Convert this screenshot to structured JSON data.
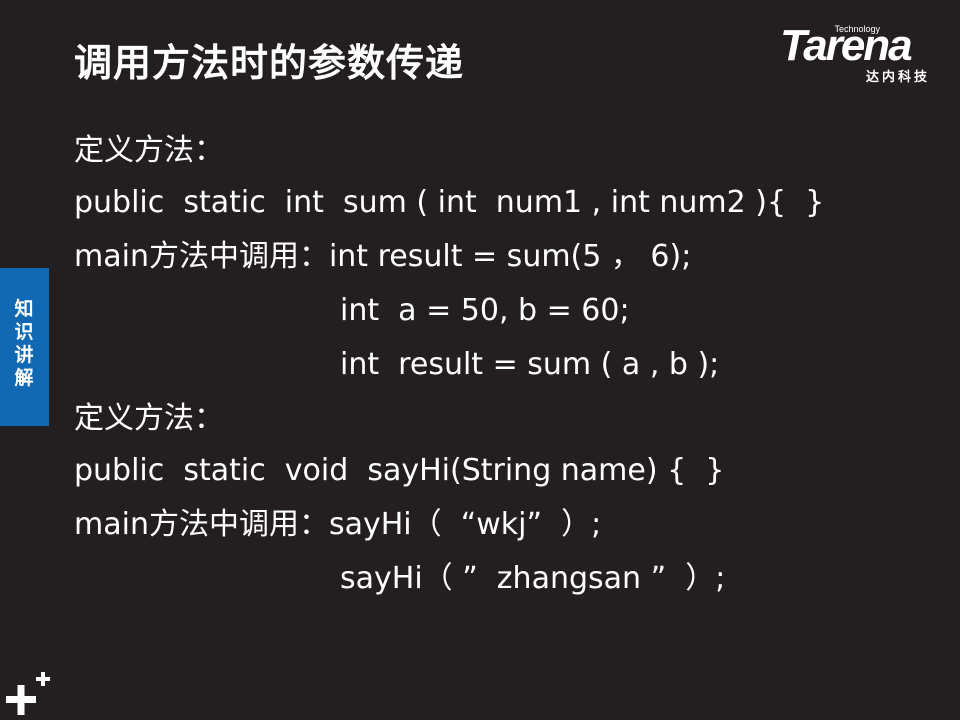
{
  "slide": {
    "title": "调用方法时的参数传递",
    "side_tab": "知识讲解",
    "logo": {
      "small": "Technology",
      "brand": "Tarena",
      "chinese": "达内科技"
    },
    "lines": [
      "定义方法：",
      "public  static  int  sum ( int  num1 , int num2 ){  }",
      "main方法中调用：int result = sum(5 ， 6);",
      "int  a = 50, b = 60;",
      "int  result = sum ( a , b );",
      "定义方法：",
      "public  static  void  sayHi(String name) {  }",
      "main方法中调用：sayHi（  “wkj”  ）;",
      "sayHi（ ”  zhangsan ”  ）;"
    ]
  },
  "colors": {
    "background": "#231f20",
    "side_tab": "#1168b3",
    "text": "#ffffff"
  },
  "icons": {
    "corner": "plus-icon"
  }
}
